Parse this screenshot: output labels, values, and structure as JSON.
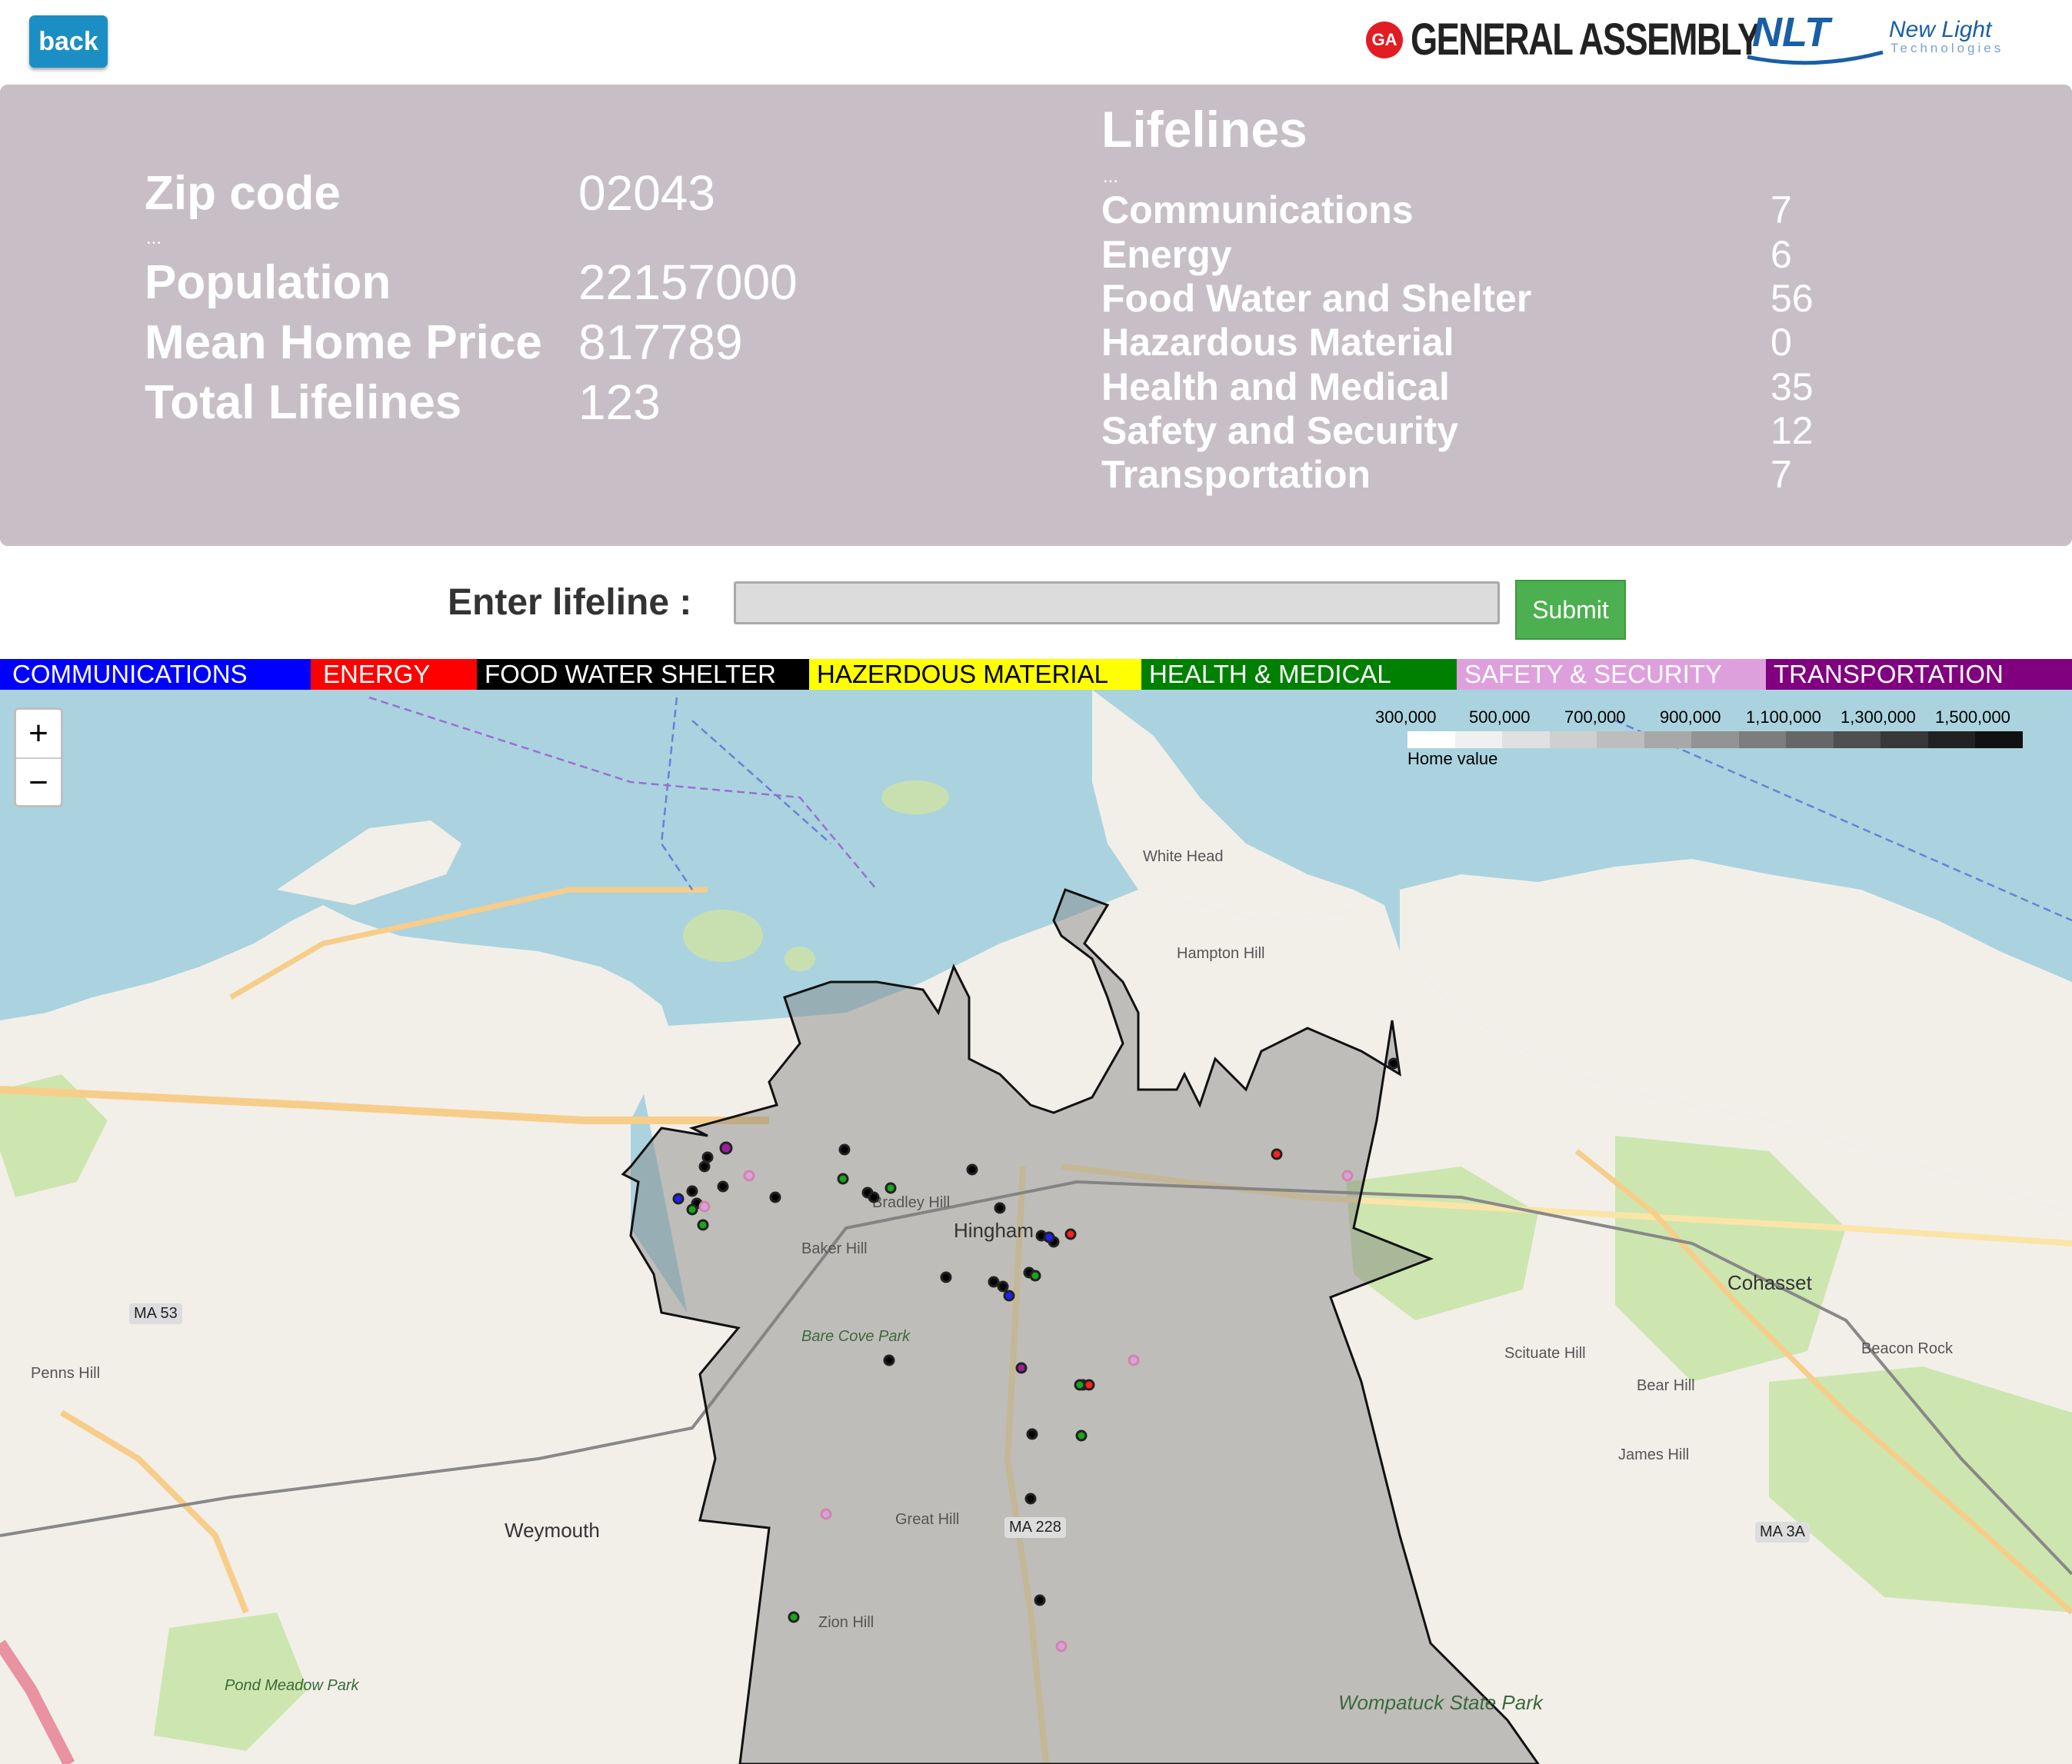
{
  "topbar": {
    "back_label": "back",
    "ga_badge": "GA",
    "ga_text": "GENERAL ASSEMBLY",
    "nlt_mark": "NLT",
    "nlt_name": "New Light",
    "nlt_sub": "Technologies"
  },
  "stats": {
    "zip_label": "Zip code",
    "zip_value": "02043",
    "ellipsis": "...",
    "population_label": "Population",
    "population_value": "22157000",
    "price_label": "Mean Home Price",
    "price_value": "817789",
    "total_label": "Total Lifelines",
    "total_value": "123"
  },
  "lifelines": {
    "title": "Lifelines",
    "ellipsis": "...",
    "items": [
      {
        "label": "Communications",
        "count": "7"
      },
      {
        "label": "Energy",
        "count": "6"
      },
      {
        "label": "Food Water and Shelter",
        "count": "56"
      },
      {
        "label": "Hazardous Material",
        "count": "0"
      },
      {
        "label": "Health and Medical",
        "count": "35"
      },
      {
        "label": "Safety and Security",
        "count": "12"
      },
      {
        "label": "Transportation",
        "count": "7"
      }
    ]
  },
  "entry": {
    "label": "Enter lifeline :",
    "value": "",
    "submit_label": "Submit"
  },
  "legend": [
    {
      "label": "COMMUNICATIONS",
      "color": "#0000ff",
      "text_color": "#ffffff"
    },
    {
      "label": "ENERGY",
      "color": "#ff0000",
      "text_color": "#ffffff"
    },
    {
      "label": "FOOD WATER SHELTER",
      "color": "#000000",
      "text_color": "#ffffff"
    },
    {
      "label": "HAZERDOUS MATERIAL",
      "color": "#ffff00",
      "text_color": "#000000"
    },
    {
      "label": "HEALTH & MEDICAL",
      "color": "#008000",
      "text_color": "#ffffff"
    },
    {
      "label": "SAFETY & SECURITY",
      "color": "#dda0dd",
      "text_color": "#ffffff"
    },
    {
      "label": "TRANSPORTATION",
      "color": "#800080",
      "text_color": "#ffffff"
    }
  ],
  "map": {
    "zoom_in": "+",
    "zoom_out": "−",
    "scale_ticks": [
      "300,000",
      "500,000",
      "700,000",
      "900,000",
      "1,100,000",
      "1,300,000",
      "1,500,000"
    ],
    "scale_caption": "Home value",
    "labels": {
      "weymouth": "Weymouth",
      "cohasset": "Cohasset",
      "hingham": "Hingham",
      "white_head": "White Head",
      "hampton_hill": "Hampton Hill",
      "bradley_hill": "Bradley Hill",
      "baker_hill": "Baker Hill",
      "great_hill": "Great Hill",
      "zion_hill": "Zion Hill",
      "scituate_hill": "Scituate Hill",
      "bear_hill": "Bear Hill",
      "james_hill": "James Hill",
      "penns_hill": "Penns Hill",
      "wompatuck": "Wompatuck State Park",
      "ma53": "MA 53",
      "ma228": "MA 228",
      "ma3a": "MA 3A",
      "pond_meadow": "Pond Meadow Park",
      "beacon_rock": "Beacon Rock",
      "bare_cove": "Bare Cove Park"
    }
  }
}
